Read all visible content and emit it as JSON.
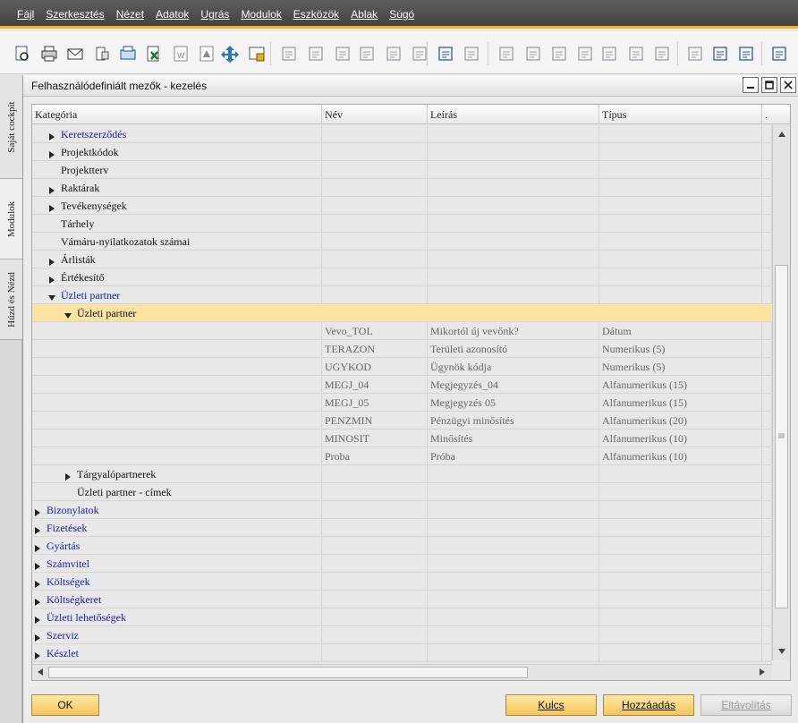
{
  "menu": [
    "Fájl",
    "Szerkesztés",
    "Nézet",
    "Adatok",
    "Ugrás",
    "Modulok",
    "Eszközök",
    "Ablak",
    "Súgó"
  ],
  "sidebar_tabs": [
    "Saját cockpit",
    "Modulok",
    "Húzd és Nézd"
  ],
  "window": {
    "title": "Felhasználódefiniált mezők - kezelés"
  },
  "columns": [
    "Kategória",
    "Név",
    "Leírás",
    "Típus",
    "."
  ],
  "tree_rows": [
    {
      "label": "Keretszerződés",
      "level": 1,
      "arrow": "right",
      "color": "blue"
    },
    {
      "label": "Projektkódok",
      "level": 1,
      "arrow": "right",
      "color": "black"
    },
    {
      "label": "Projektterv",
      "level": 1,
      "arrow": "none",
      "color": "black"
    },
    {
      "label": "Raktárak",
      "level": 1,
      "arrow": "right",
      "color": "black"
    },
    {
      "label": "Tevékenységek",
      "level": 1,
      "arrow": "right",
      "color": "black"
    },
    {
      "label": "Tárhely",
      "level": 1,
      "arrow": "none",
      "color": "black"
    },
    {
      "label": "Vámáru-nyilatkozatok számai",
      "level": 1,
      "arrow": "none",
      "color": "black"
    },
    {
      "label": "Árlisták",
      "level": 1,
      "arrow": "right",
      "color": "black"
    },
    {
      "label": "Értékesítő",
      "level": 1,
      "arrow": "right",
      "color": "black"
    },
    {
      "label": "Üzleti partner",
      "level": 1,
      "arrow": "down",
      "color": "blue"
    },
    {
      "label": "Üzleti partner",
      "level": 2,
      "arrow": "down",
      "color": "black",
      "selected": true
    }
  ],
  "fields": [
    {
      "name": "Vevo_TOL",
      "description": "Mikortól új vevőnk?",
      "type": "Dátum"
    },
    {
      "name": "TERAZON",
      "description": "Területi azonosító",
      "type": "Numerikus (5)"
    },
    {
      "name": "UGYKOD",
      "description": "Ügynök kódja",
      "type": "Numerikus (5)"
    },
    {
      "name": "MEGJ_04",
      "description": "Megjegyzés_04",
      "type": "Alfanumerikus (15)"
    },
    {
      "name": "MEGJ_05",
      "description": "Megjegyzés 05",
      "type": "Alfanumerikus (15)"
    },
    {
      "name": "PENZMIN",
      "description": "Pénzügyi minősítés",
      "type": "Alfanumerikus (20)"
    },
    {
      "name": "MINOSIT",
      "description": "Minősítés",
      "type": "Alfanumerikus (10)"
    },
    {
      "name": "Proba",
      "description": "Próba",
      "type": "Alfanumerikus (10)"
    }
  ],
  "tree_rows_after": [
    {
      "label": "Tárgyalópartnerek",
      "level": 2,
      "arrow": "right",
      "color": "black"
    },
    {
      "label": "Üzleti partner - címek",
      "level": 2,
      "arrow": "none",
      "color": "black"
    },
    {
      "label": "Bizonylatok",
      "level": 0,
      "arrow": "right",
      "color": "blue"
    },
    {
      "label": "Fizetések",
      "level": 0,
      "arrow": "right",
      "color": "blue"
    },
    {
      "label": "Gyártás",
      "level": 0,
      "arrow": "right",
      "color": "blue"
    },
    {
      "label": "Számvitel",
      "level": 0,
      "arrow": "right",
      "color": "blue"
    },
    {
      "label": "Költségek",
      "level": 0,
      "arrow": "right",
      "color": "blue"
    },
    {
      "label": "Költségkeret",
      "level": 0,
      "arrow": "right",
      "color": "blue"
    },
    {
      "label": "Üzleti lehetőségek",
      "level": 0,
      "arrow": "right",
      "color": "blue"
    },
    {
      "label": "Szerviz",
      "level": 0,
      "arrow": "right",
      "color": "blue"
    },
    {
      "label": "Készlet",
      "level": 0,
      "arrow": "right",
      "color": "blue"
    }
  ],
  "buttons": {
    "ok": "OK",
    "key": "Kulcs",
    "add": "Hozzáadás",
    "remove": "Eltávolítás"
  },
  "colors": {
    "accent": "#f0b530",
    "selected_row": "#fce3a3",
    "tree_link": "#1a1ab8"
  },
  "toolbar_icons": [
    "print-preview-icon",
    "print-icon",
    "email-icon",
    "sms-icon",
    "fax-icon",
    "export-excel-icon",
    "export-word-icon",
    "export-pdf-icon",
    "launch-icon",
    "lock-screen-icon",
    "find-icon",
    "add-icon",
    "first-record-icon",
    "previous-record-icon",
    "next-record-icon",
    "last-record-icon",
    "filter-icon",
    "sort-icon",
    "base-document-icon",
    "target-document-icon",
    "journal-icon",
    "gross-profit-icon",
    "balance-icon",
    "payment-means-icon",
    "transaction-journal-icon",
    "edit-icon",
    "settings-icon",
    "database-icon",
    "task-list-icon"
  ]
}
